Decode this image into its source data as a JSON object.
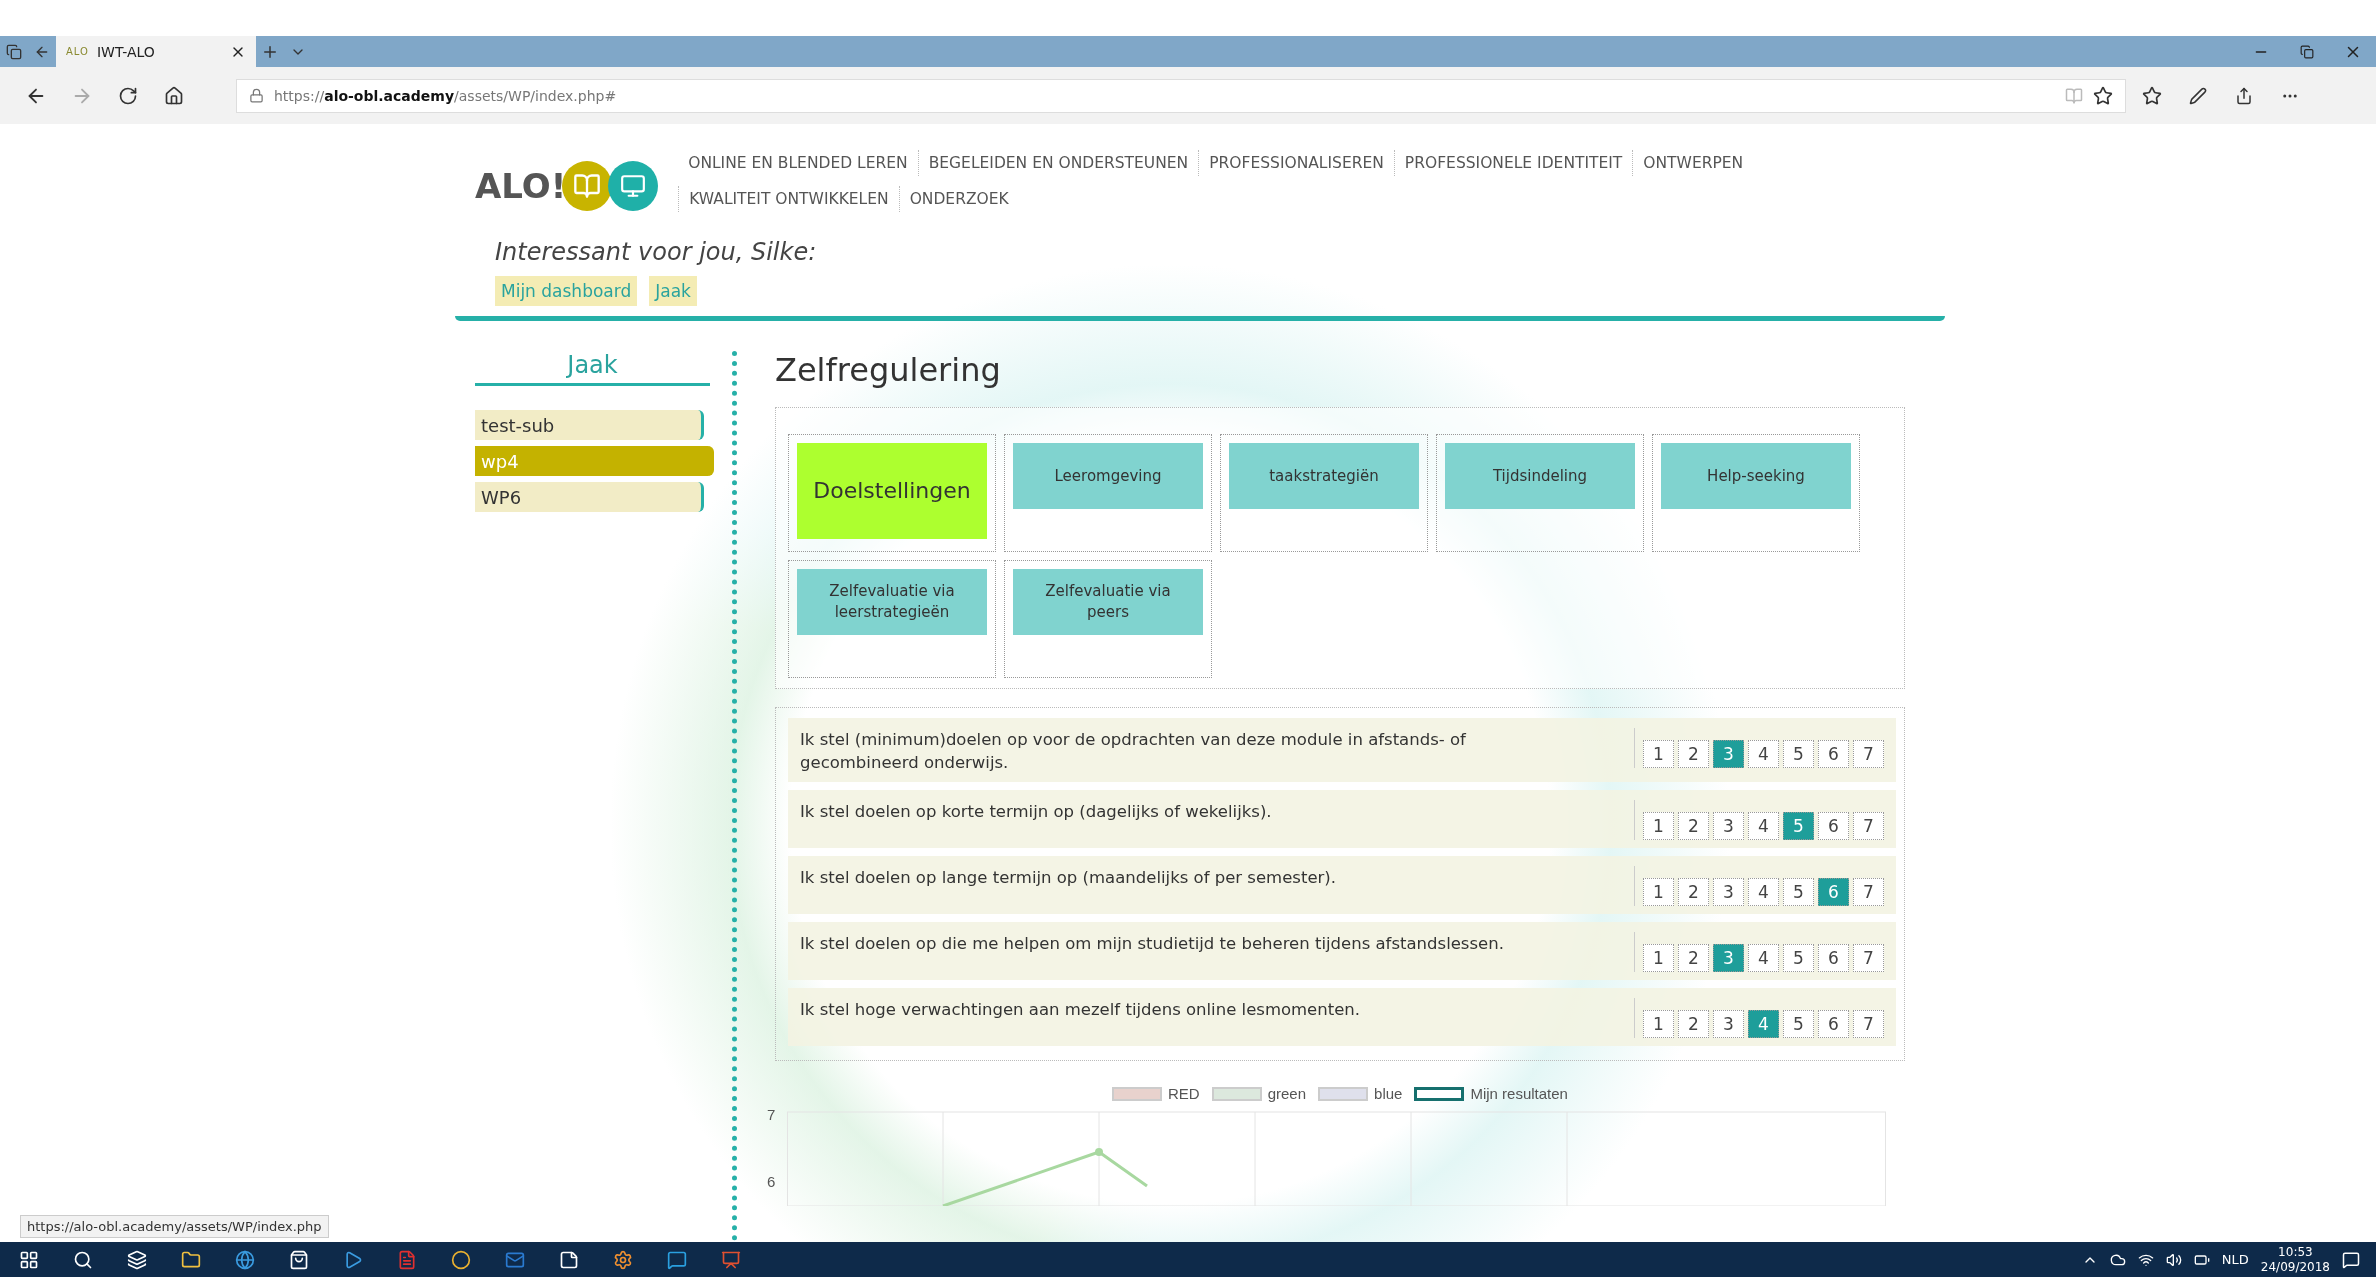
{
  "browser": {
    "tab": {
      "favicon": "ALO",
      "title": "IWT-ALO"
    },
    "url": {
      "scheme": "https://",
      "host": "alo-obl.academy",
      "path": "/assets/WP/index.php#"
    }
  },
  "site": {
    "logo": "ALO!",
    "nav": [
      "ONLINE EN BLENDED LEREN",
      "BEGELEIDEN EN ONDERSTEUNEN",
      "PROFESSIONALISEREN",
      "PROFESSIONELE IDENTITEIT",
      "ONTWERPEN",
      "KWALITEIT ONTWIKKELEN",
      "ONDERZOEK"
    ],
    "greeting": "Interessant voor jou, Silke:",
    "quick_links": [
      "Mijn dashboard",
      "Jaak"
    ]
  },
  "sidebar": {
    "title": "Jaak",
    "items": [
      {
        "label": "test-sub",
        "selected": false
      },
      {
        "label": "wp4",
        "selected": true
      },
      {
        "label": "WP6",
        "selected": false
      }
    ]
  },
  "section": {
    "title": "Zelfregulering",
    "cards": [
      {
        "label": "Doelstellingen",
        "selected": true
      },
      {
        "label": "Leeromgeving",
        "selected": false
      },
      {
        "label": "taakstrategiën",
        "selected": false
      },
      {
        "label": "Tijdsindeling",
        "selected": false
      },
      {
        "label": "Help-seeking",
        "selected": false
      },
      {
        "label": "Zelfevaluatie via leerstrategieën",
        "selected": false
      },
      {
        "label": "Zelfevaluatie via peers",
        "selected": false
      }
    ]
  },
  "questions": [
    {
      "text": "Ik stel (minimum)doelen op voor de opdrachten van deze module in afstands- of gecombineerd onderwijs.",
      "options": [
        {
          "label": "1",
          "selected": false
        },
        {
          "label": "2",
          "selected": false
        },
        {
          "label": "3",
          "selected": true
        },
        {
          "label": "4",
          "selected": false
        },
        {
          "label": "5",
          "selected": false
        },
        {
          "label": "6",
          "selected": false
        },
        {
          "label": "7",
          "selected": false
        }
      ]
    },
    {
      "text": "Ik stel doelen op korte termijn op (dagelijks of wekelijks).",
      "options": [
        {
          "label": "1",
          "selected": false
        },
        {
          "label": "2",
          "selected": false
        },
        {
          "label": "3",
          "selected": false
        },
        {
          "label": "4",
          "selected": false
        },
        {
          "label": "5",
          "selected": true
        },
        {
          "label": "6",
          "selected": false
        },
        {
          "label": "7",
          "selected": false
        }
      ]
    },
    {
      "text": "Ik stel doelen op lange termijn op (maandelijks of per semester).",
      "options": [
        {
          "label": "1",
          "selected": false
        },
        {
          "label": "2",
          "selected": false
        },
        {
          "label": "3",
          "selected": false
        },
        {
          "label": "4",
          "selected": false
        },
        {
          "label": "5",
          "selected": false
        },
        {
          "label": "6",
          "selected": true
        },
        {
          "label": "7",
          "selected": false
        }
      ]
    },
    {
      "text": "Ik stel doelen op die me helpen om mijn studietijd te beheren tijdens afstandslessen.",
      "options": [
        {
          "label": "1",
          "selected": false
        },
        {
          "label": "2",
          "selected": false
        },
        {
          "label": "3",
          "selected": true
        },
        {
          "label": "4",
          "selected": false
        },
        {
          "label": "5",
          "selected": false
        },
        {
          "label": "6",
          "selected": false
        },
        {
          "label": "7",
          "selected": false
        }
      ]
    },
    {
      "text": "Ik stel hoge verwachtingen aan mezelf tijdens online lesmomenten.",
      "options": [
        {
          "label": "1",
          "selected": false
        },
        {
          "label": "2",
          "selected": false
        },
        {
          "label": "3",
          "selected": false
        },
        {
          "label": "4",
          "selected": true
        },
        {
          "label": "5",
          "selected": false
        },
        {
          "label": "6",
          "selected": false
        },
        {
          "label": "7",
          "selected": false
        }
      ]
    }
  ],
  "chart": {
    "legend": [
      {
        "label": "RED",
        "color": "#e8d2cd"
      },
      {
        "label": "green",
        "color": "#dce8dd"
      },
      {
        "label": "blue",
        "color": "#dfe0ec"
      },
      {
        "label": "Mijn resultaten",
        "color": "#16706e"
      }
    ],
    "y_ticks": [
      "7",
      "6"
    ]
  },
  "status_url": "https://alo-obl.academy/assets/WP/index.php",
  "taskbar": {
    "language": "NLD",
    "time": "10:53",
    "date": "24/09/2018"
  }
}
